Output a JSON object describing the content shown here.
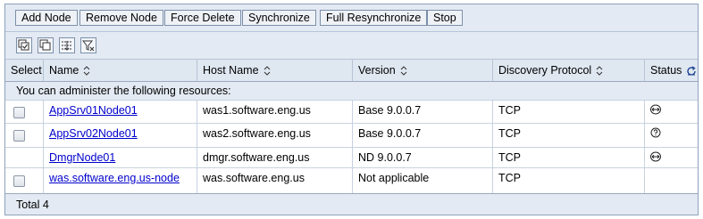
{
  "buttons": {
    "add_node": "Add Node",
    "remove_node": "Remove Node",
    "force_delete": "Force Delete",
    "synchronize": "Synchronize",
    "full_resync": "Full Resynchronize",
    "stop": "Stop"
  },
  "toolbar_icons": [
    "select-all-icon",
    "deselect-all-icon",
    "show-filter-icon",
    "clear-filter-icon"
  ],
  "columns": {
    "select": "Select",
    "name": "Name",
    "host": "Host Name",
    "version": "Version",
    "protocol": "Discovery Protocol",
    "status": "Status"
  },
  "message": "You can administer the following resources:",
  "rows": [
    {
      "name": "AppSrv01Node01",
      "host": "was1.software.eng.us",
      "version": "Base 9.0.0.7",
      "protocol": "TCP",
      "status": "synchronized"
    },
    {
      "name": "AppSrv02Node01",
      "host": "was2.software.eng.us",
      "version": "Base 9.0.0.7",
      "protocol": "TCP",
      "status": "unknown"
    },
    {
      "name": "DmgrNode01",
      "host": "dmgr.software.eng.us",
      "version": "ND 9.0.0.7",
      "protocol": "TCP",
      "status": "synchronized"
    },
    {
      "name": "was.software.eng.us-node",
      "host": "was.software.eng.us",
      "version": "Not applicable",
      "protocol": "TCP",
      "status": ""
    }
  ],
  "total": "Total 4",
  "colors": {
    "link": "#0000cc",
    "header_bg": "#dfe7f1",
    "panel_bg": "#e3eaf3",
    "border": "#8ea2bb"
  }
}
